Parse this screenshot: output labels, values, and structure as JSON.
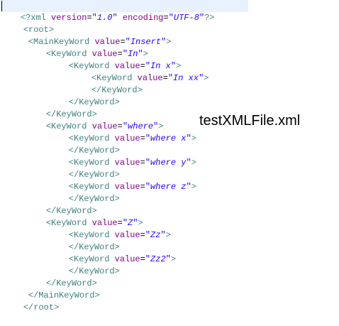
{
  "title_label": "testXMLFile.xml",
  "colors": {
    "tag": "#3f7f7f",
    "attribute": "#7f007f",
    "value": "#2a00ff",
    "current_line": "#e8f2fe"
  },
  "lines": [
    {
      "text_prefix": "<?xml ",
      "a1": "version",
      "v1": "1.0",
      "a2": "encoding",
      "v2": "UTF-8",
      "end": "?>"
    },
    {
      "tag": "<root>"
    },
    {
      "open": "<MainKeyWord ",
      "attr": "value",
      "val": "Insert",
      "end": ">"
    },
    {
      "open": "<KeyWord ",
      "attr": "value",
      "val": "In",
      "end": ">"
    },
    {
      "open": "<KeyWord ",
      "attr": "value",
      "val": "In x",
      "end": ">"
    },
    {
      "open": "<KeyWord ",
      "attr": "value",
      "val": "In xx",
      "end": ">"
    },
    {
      "tag": "</KeyWord>"
    },
    {
      "tag": "</KeyWord>"
    },
    {
      "tag": "</KeyWord>"
    },
    {
      "open": "<KeyWord ",
      "attr": "value",
      "val": "where",
      "end": ">"
    },
    {
      "open": "<KeyWord ",
      "attr": "value",
      "val": "where x",
      "end": ">"
    },
    {
      "tag": "</KeyWord>"
    },
    {
      "open": "<KeyWord ",
      "attr": "value",
      "val": "where y",
      "end": ">"
    },
    {
      "tag": "</KeyWord>"
    },
    {
      "open": "<KeyWord ",
      "attr": "value",
      "val": "where z",
      "end": ">"
    },
    {
      "tag": "</KeyWord>"
    },
    {
      "tag": "</KeyWord>"
    },
    {
      "open": "<KeyWord ",
      "attr": "value",
      "val": "Z",
      "end": ">"
    },
    {
      "open": "<KeyWord ",
      "attr": "value",
      "val": "Zz",
      "end": ">"
    },
    {
      "tag": "</KeyWord>"
    },
    {
      "open": "<KeyWord ",
      "attr": "value",
      "val": "Zz2",
      "end": ">"
    },
    {
      "tag": "</KeyWord>"
    },
    {
      "tag": "</KeyWord>"
    },
    {
      "tag": "</MainKeyWord>"
    },
    {
      "tag": "</root>"
    }
  ]
}
